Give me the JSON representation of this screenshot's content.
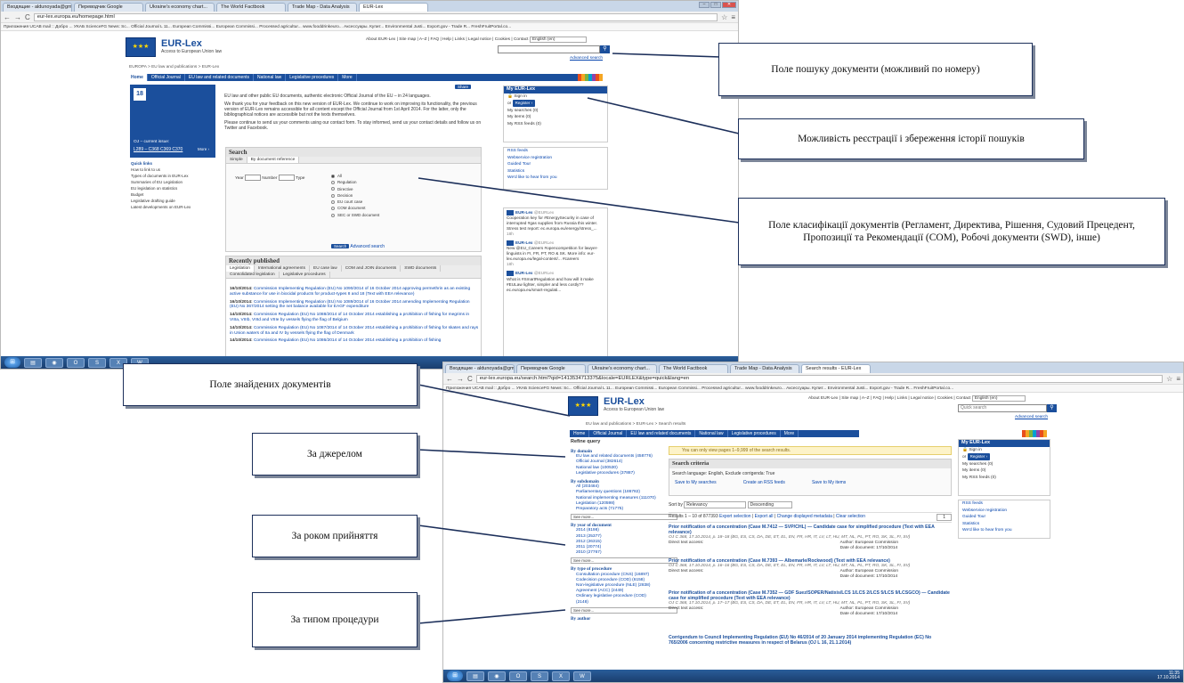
{
  "shot1": {
    "tabs": [
      "Входящие - aldunoyada@gmail...",
      "Переводчик Google",
      "Ukraine's economy chart...",
      "The World Factbook",
      "Trade Map - Data Analysis",
      "EUR-Lex"
    ],
    "url": "eur-lex.europa.eu/homepage.html",
    "bookmarks": "Приложения   UCAB mail :: Добро ...   УКАБ   ScienceFG News: Sc...   Official Journal L 11...   European Commissi...   European Commissi...   Processed agricultur...   www.fooddrinkeuro...   Аксессуары. Купит...   Environmental Justi...   Export.gov - Trade R...   FreshFruitPortal.co...",
    "brand_title": "EUR-Lex",
    "brand_sub": "Access to European Union law",
    "toplinks": "About EUR-Lex | Site map | A–Z | FAQ | Help | Links | Legal notice | Cookies | Contact",
    "language": "English (en)",
    "advanced_search": "Advanced search",
    "breadcrumb": "EUROPA > EU law and publications > EUR-Lex",
    "nav": [
      "Home",
      "Official Journal",
      "EU law and related documents",
      "National law",
      "Legislative procedures",
      "More"
    ],
    "oj_label": "OJ – current issue:",
    "oj_issues": "L289 – C368 C369 C370",
    "oj_more": "More ›",
    "oj_date": "18",
    "quick_title": "Quick links",
    "quick_links": [
      "How to link to us",
      "Types of documents in EUR-Lex",
      "Summaries of EU Legislation",
      "EU legislation on statistics",
      "Budget",
      "Legislative drafting guide",
      "Latest developments on EUR-Lex"
    ],
    "intro1": "EU law and other public EU documents, authentic electronic Official Journal of the EU – in 24 languages.",
    "intro2": "We thank you for your feedback on this new version of EUR-Lex. We continue to work on improving its functionality, the previous version of EUR-Lex remains accessible for all content except the Official Journal from 1st April 2014. For the latter, only the bibliographical notices are accessible but not the texts themselves.",
    "intro3": "Please continue to send us your comments using our contact form. To stay informed, send us your contact details and follow us on Twitter and Facebook.",
    "share_label": "Share",
    "search_title": "Search",
    "search_tabs": [
      "Simple",
      "By document reference"
    ],
    "year_label": "Year",
    "number_label": "Number",
    "type_label": "Type",
    "types": [
      "All",
      "Regulation",
      "Directive",
      "Decision",
      "EU court case",
      "COM document",
      "SEC or SWD document"
    ],
    "search_btn": "Search",
    "adv_search": "Advanced search",
    "my_title": "My EUR-Lex",
    "sign_in": "Sign in",
    "or": "or",
    "register": "Register ›",
    "my_items": [
      "My searches (0)",
      "My items (0)",
      "My RSS feeds (0)"
    ],
    "my_links": [
      "RSS feeds",
      "Webservice registration",
      "Guided Tour",
      "Statistics",
      "We'd like to hear from you"
    ],
    "tweets": [
      {
        "name": "EUR-Lex",
        "handle": "@EURLex",
        "text": "Cooperation key for #EnergySecurity in case of interrupted #gas supplies from Russia this winter. Stress test report: ec.europa.eu/energy/stress_...",
        "age": "18h"
      },
      {
        "name": "EUR-Lex",
        "handle": "@EURLex",
        "text": "New @EU_Careers #opencompetition for lawyer-linguists in FI, FR, PT, RO & SK. More info: eur-lex.europa.eu/legal-content/... #careers",
        "age": "18h"
      },
      {
        "name": "EUR-Lex",
        "handle": "@EURLex",
        "text": "What is #SmartRegulation and how will it make #EULaw lighter, simpler and less costly?? ec.europa.eu/smart-regulati...",
        "age": ""
      }
    ],
    "recent_title": "Recently published",
    "recent_tabs": [
      "Legislation",
      "International agreements",
      "EU case law",
      "COM and JOIN documents",
      "SWD documents",
      "Consolidated legislation",
      "Legislative procedures"
    ],
    "recent": [
      {
        "date": "16/10/2014:",
        "text": "Commission Implementing Regulation (EU) No 1090/2014 of 16 October 2014 approving permethrin as an existing active substance for use in biocidal products for product-types 8 and 18 (Text with EEA relevance)"
      },
      {
        "date": "16/10/2014:",
        "text": "Commission Implementing Regulation (EU) No 1089/2014 of 16 October 2014 amending Implementing Regulation (EU) No 367/2014 setting the net balance available for EAGF expenditure"
      },
      {
        "date": "14/10/2014:",
        "text": "Commission Regulation (EU) No 1088/2014 of 14 October 2014 establishing a prohibition of fishing for megrims in VIIIa, VIIIb, VIIId and VIIIe by vessels flying the flag of Belgium"
      },
      {
        "date": "14/10/2014:",
        "text": "Commission Regulation (EU) No 1087/2014 of 14 October 2014 establishing a prohibition of fishing for skates and rays in Union waters of IIa and IV by vessels flying the flag of Denmark"
      },
      {
        "date": "14/10/2014:",
        "text": "Commission Regulation (EU) No 1086/2014 of 14 October 2014 establishing a prohibition of fishing"
      }
    ]
  },
  "shot2": {
    "tabs": [
      "Входящие - aldunoyada@gmail...",
      "Переводчик Google",
      "Ukraine's economy chart...",
      "The World Factbook",
      "Trade Map - Data Analysis",
      "Search results - EUR-Lex"
    ],
    "url": "eur-lex.europa.eu/search.html?qid=1413534713375&locale=EURLEX&type=quick&lang=en",
    "bookmarks": "Приложения   UCAB mail :: Добро ...   УКАБ   ScienceFG News: Sc...   Official Journal L 11...   European Commissi...   European Commissi...   Processed agricultur...   www.fooddrinkeuro...   Аксессуары. Купит...   Environmental Justi...   Export.gov - Trade R...   FreshFruitPortal.co...",
    "brand_title": "EUR-Lex",
    "brand_sub": "Access to European Union law",
    "toplinks": "About EUR-Lex | Site map | A–Z | FAQ | Help | Links | Legal notice | Cookies | Contact",
    "language": "English (en)",
    "quick_search": "Quick search",
    "advanced_search": "Advanced search",
    "breadcrumb": "EU law and publications > EUR-Lex > Search results",
    "nav": [
      "Home",
      "Official Journal",
      "EU law and related documents",
      "National law",
      "Legislative procedures",
      "More"
    ],
    "refine_title": "Refine query",
    "groups": [
      {
        "title": "By domain",
        "items": [
          "EU law and related documents (458776)",
          "Official Journal (382614)",
          "National law (100530)",
          "Legislative procedures (37887)"
        ]
      },
      {
        "title": "By subdomain",
        "items": [
          "All (203484)",
          "Parliamentary questions (186782)",
          "National implementing measures (111070)",
          "Legislation (120598)",
          "Preparatory acts (71775)"
        ]
      },
      {
        "title": "By year of document",
        "items": [
          "2014 (8198)",
          "2013 (25377)",
          "2012 (26315)",
          "2011 (20774)",
          "2010 (27767)"
        ]
      },
      {
        "title": "By type of procedure",
        "items": [
          "Consultation procedure (CNS) (16897)",
          "Codecision procedure (COD) (6158)",
          "Non-legislative procedure (NLE) (2838)",
          "Agreement (ACC) (2449)",
          "Ordinary legislative procedure (COD) (2148)"
        ]
      }
    ],
    "see_more": "See more...",
    "by_author": "By author",
    "warning": "You can only view pages 1–9,999 of the search results.",
    "criteria_title": "Search criteria",
    "criteria_text": "Search language: English, Exclude corrigenda: True",
    "criteria_actions": [
      "Save to My searches",
      "Create an RSS feeds",
      "Save to My items"
    ],
    "sort_label": "Sort by",
    "sort_value": "Relevancy",
    "sort_order": "Descending",
    "results_label": "Results 1 – 10 of 877393",
    "results_actions": [
      "Export selection",
      "Export all",
      "Change displayed metadata",
      "Clear selection"
    ],
    "pager": "1",
    "results": [
      {
        "title": "Prior notification of a concentration (Case M.7412 — SVP/CHL) — Candidate case for simplified procedure (Text with EEA relevance)",
        "meta": "OJ C 368, 17.10.2014, p. 18–18 (BG, ES, CS, DA, DE, ET, EL, EN, FR, HR, IT, LV, LT, HU, MT, NL, PL, PT, RO, SK, SL, FI, SV)",
        "author": "Author: European Commission",
        "date": "Date of document: 17/10/2014"
      },
      {
        "title": "Prior notification of a concentration (Case M.7393 — Albemarle/Rockwood) (Text with EEA relevance)",
        "meta": "OJ C 368, 17.10.2014, p. 16–16 (BG, ES, CS, DA, DE, ET, EL, EN, FR, HR, IT, LV, LT, HU, MT, NL, PL, PT, RO, SK, SL, FI, SV)",
        "author": "Author: European Commission",
        "date": "Date of document: 17/10/2014"
      },
      {
        "title": "Prior notification of a concentration (Case M.7352 — GDF Suez/SOPER/Natixis/LCS 1/LCS 2/LCS 5/LCS 9/LCSGCO) — Candidate case for simplified procedure (Text with EEA relevance)",
        "meta": "OJ C 368, 17.10.2014, p. 17–17 (BG, ES, CS, DA, DE, ET, EL, EN, FR, HR, IT, LV, LT, HU, MT, NL, PL, PT, RO, SK, SL, FI, SV)",
        "author": "Author: European Commission",
        "date": "Date of document: 17/10/2014"
      },
      {
        "title": "Corrigendum to Council Implementing Regulation (EU) No 46/2014 of 20 January 2014 implementing Regulation (EC) No 765/2006 concerning restrictive measures in respect of Belarus (OJ L 16, 21.1.2014)",
        "meta": "",
        "author": "",
        "date": ""
      }
    ],
    "direct_access": "Direct text access:",
    "my_title": "My EUR-Lex",
    "sign_in": "Sign in",
    "or": "or",
    "register": "Register ›",
    "my_items": [
      "My searches (0)",
      "My items (0)",
      "My RSS feeds (0)"
    ],
    "my_links": [
      "RSS feeds",
      "Webservice registration",
      "Guided Tour",
      "Statistics",
      "We'd like to hear from you"
    ]
  },
  "taskbar": {
    "clock1": "11:35",
    "date1": "17.10.2014",
    "lang": "UK"
  },
  "annotations": {
    "search_field": "Поле пошуку документи (можливий по номеру)",
    "register": "Можливість реєстрації і збереження історії пошуків",
    "classification": "Поле класифікації документів (Регламент, Директива, Рішення, Судовий Прецедент, Пропозиції та Рекомендації (COM), Робочі документи (SWD), інше)",
    "found": "Поле знайдених документів",
    "by_source": "За джерелом",
    "by_year": "За роком прийняття",
    "by_procedure": "За типом процедури"
  },
  "colors": {
    "eu_blue": "#1b4f9c",
    "annotation_border": "#1c2f5a"
  }
}
